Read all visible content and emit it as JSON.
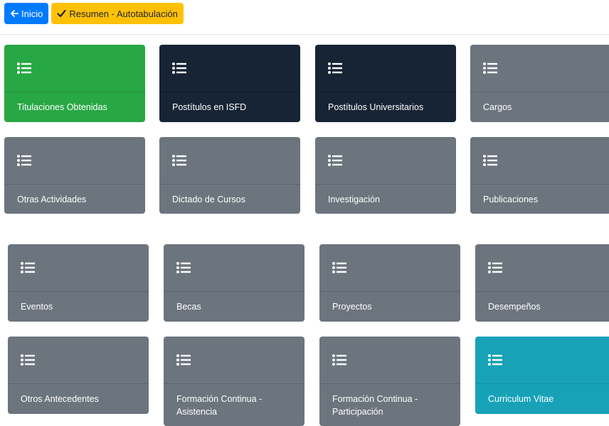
{
  "toolbar": {
    "home_label": "Inicio",
    "summary_label": "Resumen - Autotabulación",
    "home_icon": "arrow-left-icon",
    "summary_icon": "check-icon"
  },
  "colors": {
    "primary": "#007bff",
    "warning": "#ffc107",
    "gray": "#6c757d",
    "dark": "#172435",
    "green": "#28a745",
    "cyan": "#17a2b8"
  },
  "tiles": [
    {
      "label": "Titulaciones Obtenidas",
      "color": "green",
      "icon": "list-icon"
    },
    {
      "label": "Postítulos en ISFD",
      "color": "dark",
      "icon": "list-icon"
    },
    {
      "label": "Postítulos Universitarios",
      "color": "dark",
      "icon": "list-icon"
    },
    {
      "label": "Cargos",
      "color": "gray",
      "icon": "list-icon"
    },
    {
      "label": "Otras Actividades",
      "color": "gray",
      "icon": "list-icon"
    },
    {
      "label": "Dictado de Cursos",
      "color": "gray",
      "icon": "list-icon"
    },
    {
      "label": "Investigación",
      "color": "gray",
      "icon": "list-icon"
    },
    {
      "label": "Publicaciones",
      "color": "gray",
      "icon": "list-icon"
    },
    {
      "label": "Eventos",
      "color": "gray",
      "icon": "list-icon"
    },
    {
      "label": "Becas",
      "color": "gray",
      "icon": "list-icon"
    },
    {
      "label": "Proyectos",
      "color": "gray",
      "icon": "list-icon"
    },
    {
      "label": "Desempeños",
      "color": "gray",
      "icon": "list-icon"
    },
    {
      "label": "Otros Antecedentes",
      "color": "gray",
      "icon": "list-icon"
    },
    {
      "label": "Formación Continua - Asistencia",
      "color": "gray",
      "icon": "list-icon"
    },
    {
      "label": "Formación Continua - Participación",
      "color": "gray",
      "icon": "list-icon"
    },
    {
      "label": "Curriculum Vitae",
      "color": "cyan",
      "icon": "list-icon"
    }
  ]
}
